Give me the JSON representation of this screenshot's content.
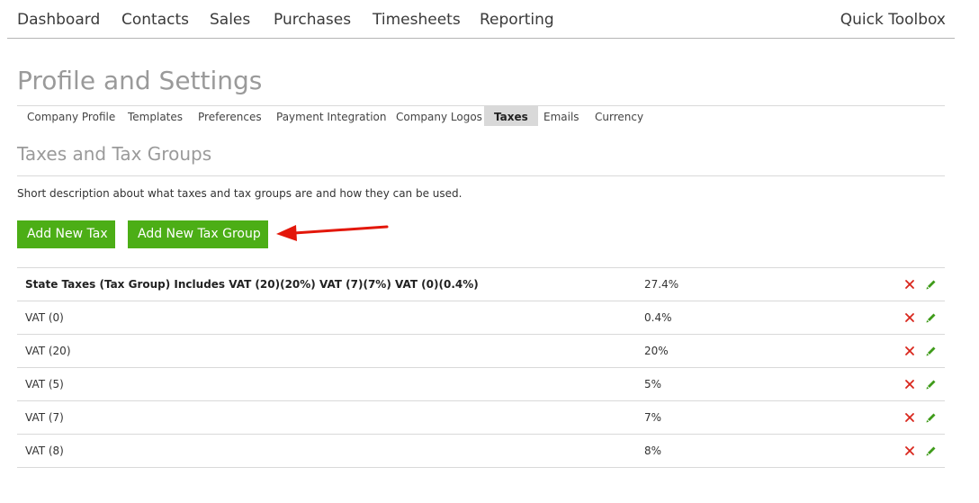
{
  "topnav": {
    "items": [
      "Dashboard",
      "Contacts",
      "Sales",
      "Purchases",
      "Timesheets",
      "Reporting"
    ],
    "right": "Quick Toolbox"
  },
  "page": {
    "title": "Profile and Settings"
  },
  "subnav": {
    "tabs": [
      "Company Profile",
      "Templates",
      "Preferences",
      "Payment Integration",
      "Company Logos",
      "Taxes",
      "Emails",
      "Currency"
    ],
    "active": "Taxes"
  },
  "section": {
    "title": "Taxes and Tax Groups",
    "description": "Short description about what taxes and tax groups are and how they can be used."
  },
  "buttons": {
    "add_tax": "Add New Tax",
    "add_tax_group": "Add New Tax Group"
  },
  "colors": {
    "button_green": "#4cae16",
    "delete_red": "#d9261c",
    "edit_green": "#3f9b1a",
    "arrow_red": "#e3170a"
  },
  "icons": {
    "delete": "close-icon",
    "edit": "pencil-icon"
  },
  "taxes": [
    {
      "name": "State Taxes (Tax Group) Includes VAT (20)(20%) VAT (7)(7%) VAT (0)(0.4%)",
      "rate": "27.4%",
      "group": true
    },
    {
      "name": "VAT (0)",
      "rate": "0.4%",
      "group": false
    },
    {
      "name": "VAT (20)",
      "rate": "20%",
      "group": false
    },
    {
      "name": "VAT (5)",
      "rate": "5%",
      "group": false
    },
    {
      "name": "VAT (7)",
      "rate": "7%",
      "group": false
    },
    {
      "name": "VAT (8)",
      "rate": "8%",
      "group": false
    }
  ]
}
